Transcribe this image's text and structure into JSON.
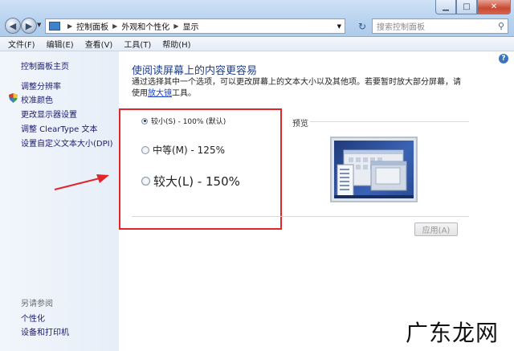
{
  "breadcrumb": [
    "控制面板",
    "外观和个性化",
    "显示"
  ],
  "search": {
    "placeholder": "搜索控制面板"
  },
  "menu": [
    "文件(F)",
    "编辑(E)",
    "查看(V)",
    "工具(T)",
    "帮助(H)"
  ],
  "sidebar": {
    "home": "控制面板主页",
    "items": [
      "调整分辨率",
      "校准颜色",
      "更改显示器设置",
      "调整 ClearType 文本",
      "设置自定义文本大小(DPI)"
    ],
    "see_also_title": "另请参阅",
    "see_also": [
      "个性化",
      "设备和打印机"
    ]
  },
  "main": {
    "title": "使阅读屏幕上的内容更容易",
    "description": "通过选择其中一个选项，可以更改屏幕上的文本大小以及其他项。若要暂时放大部分屏幕，请使用",
    "magnifier_link": "放大镜",
    "description_end": "工具。",
    "options": [
      {
        "label": "较小(S) - 100% (默认)",
        "selected": true
      },
      {
        "label": "中等(M) - 125%",
        "selected": false
      },
      {
        "label": "较大(L) - 150%",
        "selected": false
      }
    ],
    "preview_label": "预览",
    "apply_button": "应用(A)"
  },
  "watermark": "广东龙网",
  "colors": {
    "highlight_box": "#e0262a",
    "link": "#1a40c0",
    "heading": "#1f3f8a"
  }
}
